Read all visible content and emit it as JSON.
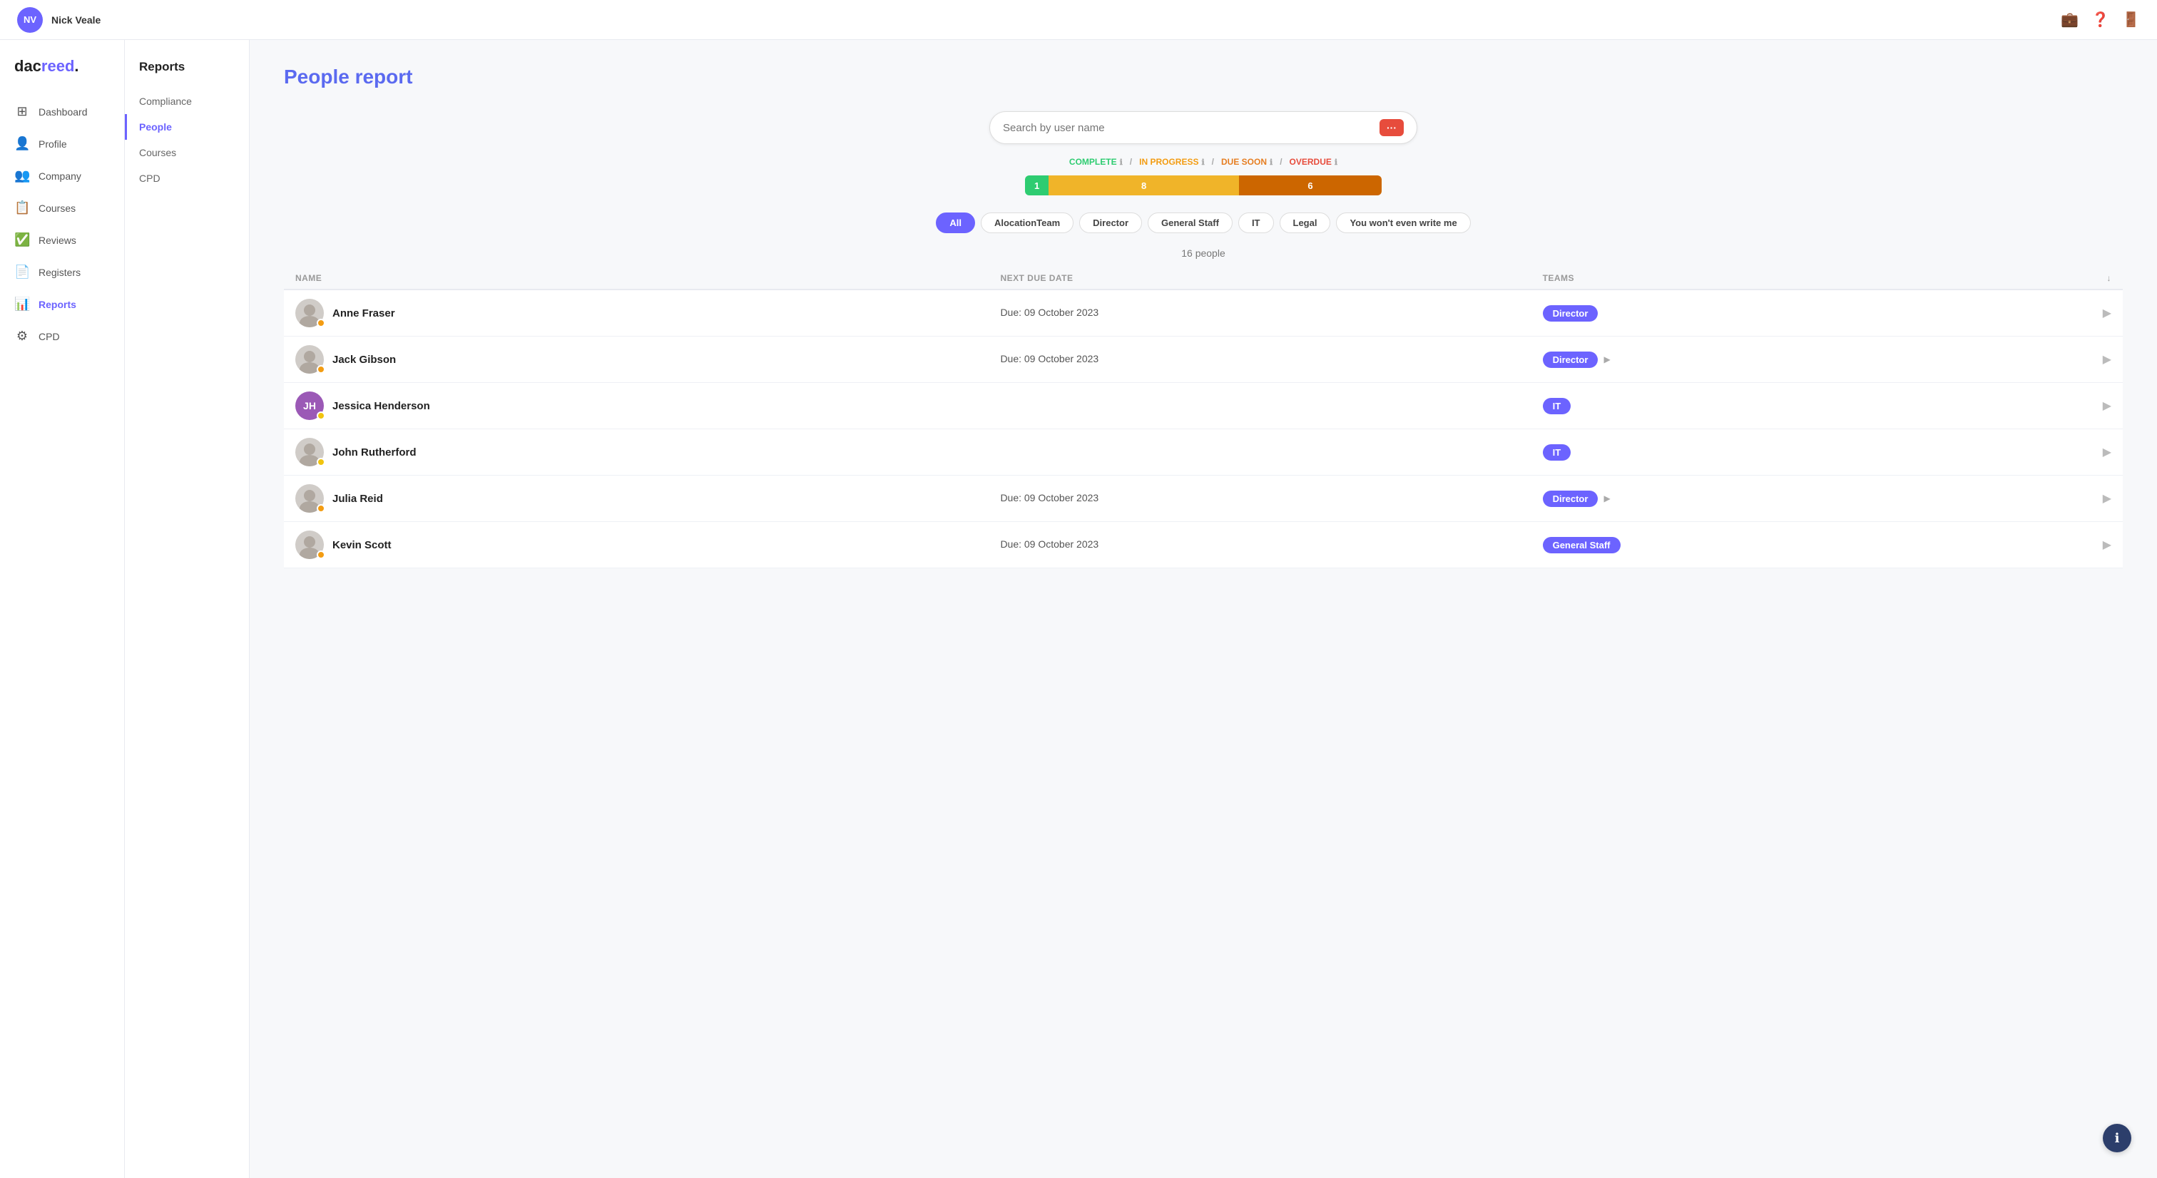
{
  "topNav": {
    "userInitials": "NV",
    "userName": "Nick Veale",
    "icons": [
      "briefcase-icon",
      "help-icon",
      "logout-icon"
    ]
  },
  "sidebar": {
    "logo": {
      "text1": "dac",
      "text2": "reed",
      "dot": "."
    },
    "items": [
      {
        "id": "dashboard",
        "label": "Dashboard",
        "icon": "⊞",
        "active": false
      },
      {
        "id": "profile",
        "label": "Profile",
        "icon": "👤",
        "active": false
      },
      {
        "id": "company",
        "label": "Company",
        "icon": "👥",
        "active": false
      },
      {
        "id": "courses",
        "label": "Courses",
        "icon": "📋",
        "active": false
      },
      {
        "id": "reviews",
        "label": "Reviews",
        "icon": "✅",
        "active": false
      },
      {
        "id": "registers",
        "label": "Registers",
        "icon": "📄",
        "active": false
      },
      {
        "id": "reports",
        "label": "Reports",
        "icon": "📊",
        "active": true
      },
      {
        "id": "cpd",
        "label": "CPD",
        "icon": "⚙",
        "active": false
      }
    ]
  },
  "subSidebar": {
    "title": "Reports",
    "items": [
      {
        "id": "compliance",
        "label": "Compliance",
        "active": false
      },
      {
        "id": "people",
        "label": "People",
        "active": true
      },
      {
        "id": "courses",
        "label": "Courses",
        "active": false
      },
      {
        "id": "cpd",
        "label": "CPD",
        "active": false
      }
    ]
  },
  "main": {
    "title": "People report",
    "search": {
      "placeholder": "Search by user name",
      "buttonLabel": "···"
    },
    "legend": {
      "complete": "COMPLETE",
      "inprogress": "IN PROGRESS",
      "duesoon": "DUE SOON",
      "overdue": "OVERDUE"
    },
    "progressBar": {
      "complete": {
        "value": 1,
        "label": "1"
      },
      "inprogress": {
        "value": 8,
        "label": "8"
      },
      "overdue": {
        "value": 6,
        "label": "6"
      }
    },
    "filters": {
      "active": "All",
      "options": [
        "All",
        "AlocationTeam",
        "Director",
        "General Staff",
        "IT",
        "Legal",
        "You won't even write me"
      ]
    },
    "peopleCount": "16 people",
    "tableHeaders": {
      "name": "NAME",
      "nextDueDate": "NEXT DUE DATE",
      "teams": "TEAMS",
      "download": "↓"
    },
    "people": [
      {
        "id": 1,
        "name": "Anne Fraser",
        "avatarColor": "#ccc",
        "avatarType": "photo",
        "statusDotColor": "orange",
        "dueDate": "Due: 09 October 2023",
        "teams": [
          "Director"
        ],
        "hasExpand": false
      },
      {
        "id": 2,
        "name": "Jack Gibson",
        "avatarColor": "#ccc",
        "avatarType": "photo",
        "statusDotColor": "orange",
        "dueDate": "Due: 09 October 2023",
        "teams": [
          "Director"
        ],
        "hasExpand": true
      },
      {
        "id": 3,
        "name": "Jessica Henderson",
        "avatarColor": "#9b59b6",
        "avatarType": "initials",
        "initials": "JH",
        "statusDotColor": "yellow",
        "dueDate": "",
        "teams": [
          "IT"
        ],
        "hasExpand": false
      },
      {
        "id": 4,
        "name": "John Rutherford",
        "avatarColor": "#ccc",
        "avatarType": "photo",
        "statusDotColor": "yellow",
        "dueDate": "",
        "teams": [
          "IT"
        ],
        "hasExpand": false
      },
      {
        "id": 5,
        "name": "Julia Reid",
        "avatarColor": "#ccc",
        "avatarType": "photo",
        "statusDotColor": "orange",
        "dueDate": "Due: 09 October 2023",
        "teams": [
          "Director"
        ],
        "hasExpand": true
      },
      {
        "id": 6,
        "name": "Kevin Scott",
        "avatarColor": "#ccc",
        "avatarType": "photo",
        "statusDotColor": "orange",
        "dueDate": "Due: 09 October 2023",
        "teams": [
          "General Staff"
        ],
        "hasExpand": false
      }
    ]
  },
  "colors": {
    "accent": "#6c63ff",
    "complete": "#2ecc71",
    "inprogress": "#f0b429",
    "overdue": "#cc6600",
    "overdue_text": "#e74c3c"
  }
}
